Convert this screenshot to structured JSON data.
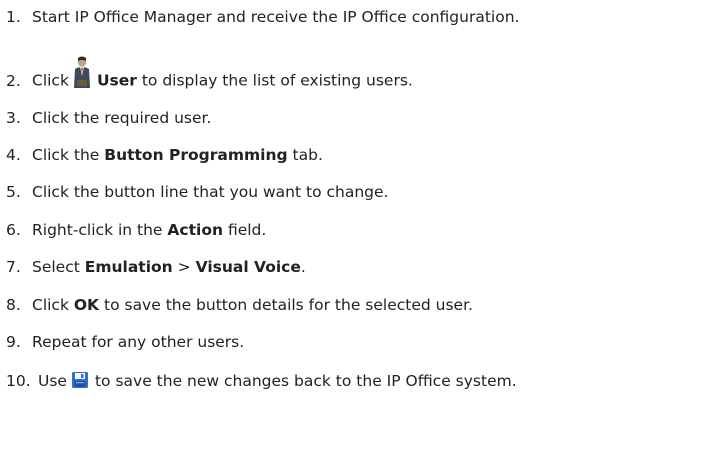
{
  "steps": [
    {
      "num": "1.",
      "parts": [
        "Start IP Office Manager and receive the IP Office configuration."
      ]
    },
    {
      "num": "2.",
      "pre": "Click",
      "bold": "User",
      "post": "to display the list of existing users.",
      "icon": "user-icon"
    },
    {
      "num": "3.",
      "parts": [
        "Click the required user."
      ]
    },
    {
      "num": "4.",
      "pre": "Click the",
      "bold": "Button Programming",
      "post": "tab."
    },
    {
      "num": "5.",
      "parts": [
        "Click the button line that you want to change."
      ]
    },
    {
      "num": "6.",
      "pre": "Right-click in the",
      "bold": "Action",
      "post": "field."
    },
    {
      "num": "7.",
      "pre": "Select",
      "bold1": "Emulation",
      "mid": ">",
      "bold2": "Visual Voice",
      "post": "."
    },
    {
      "num": "8.",
      "pre": "Click",
      "bold": "OK",
      "post": "to save the button details for the selected user."
    },
    {
      "num": "9.",
      "parts": [
        "Repeat for any other users."
      ]
    },
    {
      "num": "10.",
      "pre": "Use",
      "post": "to save the new changes back to the IP Office system.",
      "icon": "save-disk-icon"
    }
  ]
}
